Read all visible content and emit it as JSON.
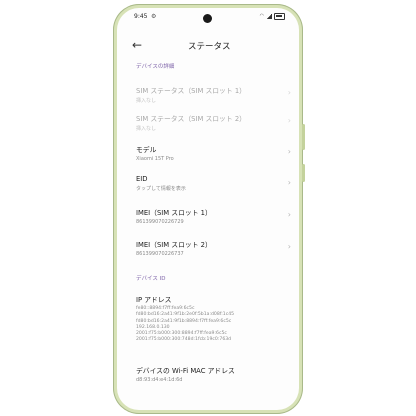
{
  "status_bar": {
    "time": "9:45",
    "settings_glyph": "⚙"
  },
  "header": {
    "back_glyph": "←",
    "title": "ステータス"
  },
  "sections": {
    "device_details": "デバイスの詳細",
    "device_id": "デバイス ID"
  },
  "items": {
    "sim_status_1": {
      "title": "SIM ステータス（SIM スロット 1）",
      "sub": "挿入なし"
    },
    "sim_status_2": {
      "title": "SIM ステータス（SIM スロット 2）",
      "sub": "挿入なし"
    },
    "model": {
      "title": "モデル",
      "sub": "Xiaomi 15T Pro"
    },
    "eid": {
      "title": "EID",
      "sub": "タップして情報を表示"
    },
    "imei_1": {
      "title": "IMEI（SIM スロット 1）",
      "sub": "861399070226729"
    },
    "imei_2": {
      "title": "IMEI（SIM スロット 2）",
      "sub": "861399070226737"
    },
    "ip_address": {
      "title": "IP アドレス",
      "lines": [
        "fe80::8894:f7ff:fea9:6c5c",
        "fd80:bd16:2a41:9f1b:2e0f:5b1a:d08f:1c45",
        "fd80:bd16:2a41:9f1b:8894:f7ff:fea9:6c5c",
        "192.168.0.130",
        "2001:f75:b000:300:8894:f7ff:fea9:6c5c",
        "2001:f75:b000:300:748d:1fcb:19c0:763d"
      ]
    },
    "wifi_mac": {
      "title": "デバイスの Wi-Fi MAC アドレス",
      "sub": "d8:93:d4:e4:1d:6d"
    }
  },
  "chevron_glyph": "›",
  "colors": {
    "section_accent": "#7d62a8",
    "frame": "#d7e2b6"
  }
}
